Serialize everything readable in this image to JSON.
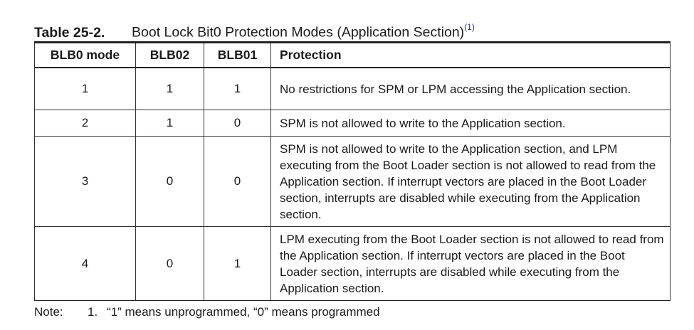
{
  "caption": {
    "number": "Table 25-2.",
    "title": "Boot Lock Bit0 Protection Modes (Application Section)",
    "footnote_ref": "(1)"
  },
  "table": {
    "headers": [
      "BLB0 mode",
      "BLB02",
      "BLB01",
      "Protection"
    ],
    "rows": [
      {
        "mode": "1",
        "blb02": "1",
        "blb01": "1",
        "protection": "No restrictions for SPM or LPM accessing the Application section."
      },
      {
        "mode": "2",
        "blb02": "1",
        "blb01": "0",
        "protection": "SPM is not allowed to write to the Application section."
      },
      {
        "mode": "3",
        "blb02": "0",
        "blb01": "0",
        "protection": "SPM is not allowed to write to the Application section, and LPM executing from the Boot Loader section is not allowed to read from the Application section. If interrupt vectors are placed in the Boot Loader section, interrupts are disabled while executing from the Application section."
      },
      {
        "mode": "4",
        "blb02": "0",
        "blb01": "1",
        "protection": "LPM executing from the Boot Loader section is not allowed to read from the Application section. If interrupt vectors are placed in the Boot Loader section, interrupts are disabled while executing from the Application section."
      }
    ]
  },
  "note": {
    "label": "Note:",
    "number": "1.",
    "text": "“1” means unprogrammed, “0” means programmed"
  },
  "colors": {
    "footnote_link": "#1a2fd0",
    "border": "#333333"
  }
}
